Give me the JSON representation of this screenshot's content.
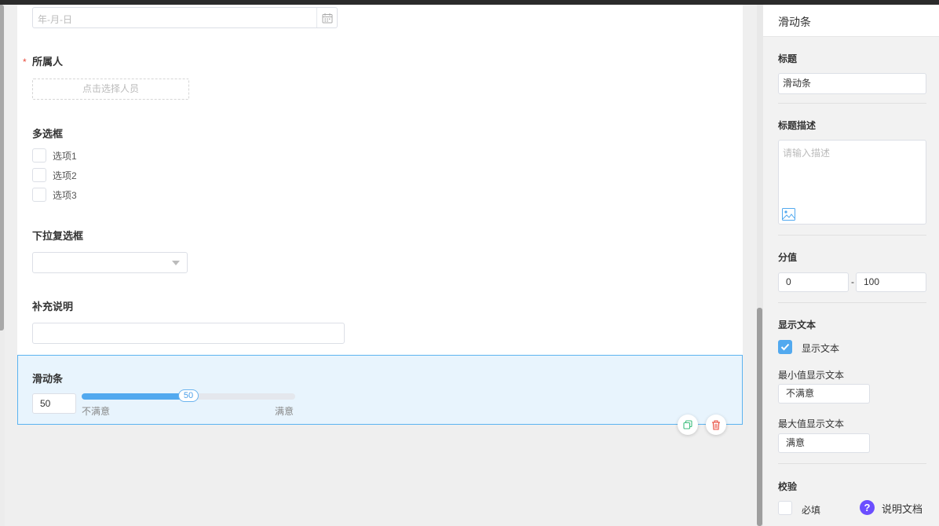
{
  "form": {
    "date_placeholder": "年-月-日",
    "owner_label": "所属人",
    "required_mark": "*",
    "select_person": "点击选择人员",
    "checkbox_label": "多选框",
    "options": [
      "选项1",
      "选项2",
      "选项3"
    ],
    "multiselect_label": "下拉复选框",
    "note_label": "补充说明",
    "slider": {
      "label": "滑动条",
      "value": "50",
      "value_number": 50,
      "min": 0,
      "max": 100,
      "min_text": "不满意",
      "max_text": "满意"
    }
  },
  "panel": {
    "title": "滑动条",
    "title_label": "标题",
    "title_value": "滑动条",
    "desc_label": "标题描述",
    "desc_placeholder": "请输入描述",
    "score_label": "分值",
    "score_min": "0",
    "score_sep": "-",
    "score_max": "100",
    "show_text_label": "显示文本",
    "show_text_checkbox": "显示文本",
    "min_text_label": "最小值显示文本",
    "min_text_value": "不满意",
    "max_text_label": "最大值显示文本",
    "max_text_value": "满意",
    "validate_label": "校验",
    "required_label": "必填",
    "help_text": "说明文档",
    "help_glyph": "?"
  },
  "colors": {
    "accent": "#52a9ef",
    "selected_bg": "#e8f4fd",
    "required": "#e84b3c",
    "help": "#6b4eff",
    "copy_icon": "#3dbd7d",
    "delete_icon": "#e84b3c"
  }
}
